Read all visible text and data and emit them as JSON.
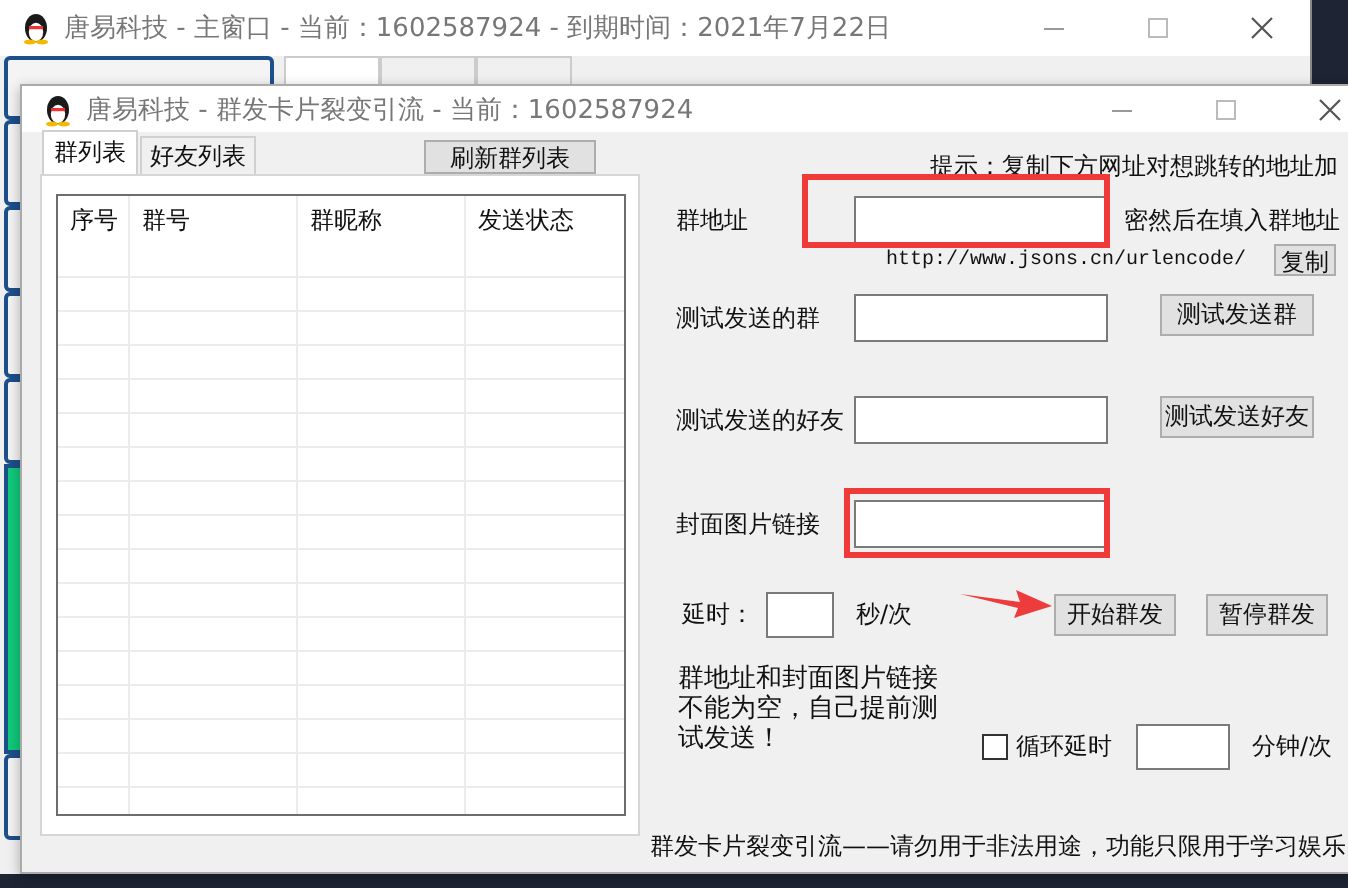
{
  "main_window": {
    "title": "唐易科技 - 主窗口 - 当前：1602587924 - 到期时间：2021年7月22日",
    "tabs": [
      {
        "selected": true
      },
      {
        "selected": false
      },
      {
        "selected": false
      }
    ]
  },
  "dialog": {
    "title": "唐易科技 - 群发卡片裂变引流 - 当前：1602587924",
    "list_tabs": [
      {
        "label": "群列表",
        "selected": true
      },
      {
        "label": "好友列表",
        "selected": false
      }
    ],
    "refresh_button": "刷新群列表",
    "table": {
      "columns": [
        "序号",
        "群号",
        "群昵称",
        "发送状态"
      ]
    },
    "hint": "提示：复制下方网址对想跳转的地址加",
    "group_address": {
      "label": "群地址",
      "highlighted": true,
      "note": "密然后在填入群地址"
    },
    "url": "http://www.jsons.cn/urlencode/",
    "copy_button": "复制",
    "test_group": {
      "label": "测试发送的群",
      "button": "测试发送群"
    },
    "test_friend": {
      "label": "测试发送的好友",
      "button": "测试发送好友"
    },
    "cover_link": {
      "label": "封面图片链接",
      "highlighted": true
    },
    "delay": {
      "label": "延时：",
      "unit": "秒/次"
    },
    "start_button": "开始群发",
    "pause_button": "暂停群发",
    "warning": "群地址和封面图片链接不能为空，自己提前测试发送！",
    "loop": {
      "label": "循环延时",
      "checked": false,
      "unit": "分钟/次"
    },
    "footer": "群发卡片裂变引流——请勿用于非法用途，功能只限用于学习娱乐"
  }
}
